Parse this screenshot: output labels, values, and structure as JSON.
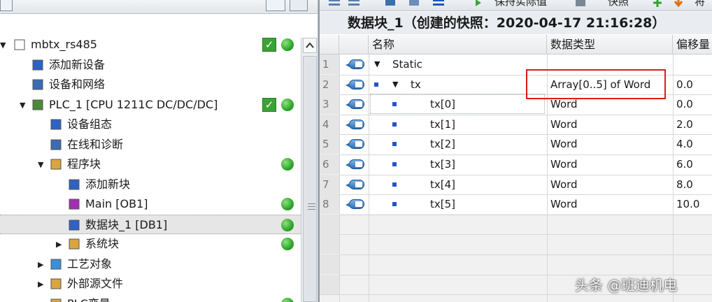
{
  "left_panel": {
    "items": [
      {
        "label": "mbtx_rs485",
        "arrow": "▼",
        "check": true,
        "dot": true,
        "icon": "document-icon"
      },
      {
        "label": "添加新设备",
        "icon": "add-device-icon"
      },
      {
        "label": "设备和网络",
        "icon": "network-icon"
      },
      {
        "label": "PLC_1 [CPU 1211C DC/DC/DC]",
        "arrow": "▼",
        "check": true,
        "dot": true,
        "icon": "plc-icon"
      },
      {
        "label": "设备组态",
        "icon": "device-config-icon"
      },
      {
        "label": "在线和诊断",
        "icon": "diagnostics-icon"
      },
      {
        "label": "程序块",
        "arrow": "▼",
        "dot": true,
        "icon": "folder-icon"
      },
      {
        "label": "添加新块",
        "icon": "add-block-icon"
      },
      {
        "label": "Main [OB1]",
        "dot": true,
        "icon": "ob-block-icon"
      },
      {
        "label": "数据块_1 [DB1]",
        "dot": true,
        "selected": true,
        "icon": "db-block-icon"
      },
      {
        "label": "系统块",
        "arrow": "▶",
        "dot": true,
        "icon": "folder-icon"
      },
      {
        "label": "工艺对象",
        "arrow": "▶",
        "icon": "tech-object-icon"
      },
      {
        "label": "外部源文件",
        "arrow": "▶",
        "icon": "external-source-icon"
      },
      {
        "label": "PLC变量",
        "arrow": "▶",
        "dot": true,
        "icon": "folder-icon"
      }
    ]
  },
  "editor": {
    "toolbar": {
      "keep_actual": "保持实际值",
      "snapshot": "快照"
    },
    "title": "数据块_1（创建的快照：2020-04-17 21:16:28）",
    "columns": {
      "name": "名称",
      "datatype": "数据类型",
      "offset": "偏移量"
    },
    "rows": [
      {
        "num": "1",
        "name": "Static",
        "datatype": "",
        "offset": "",
        "level": 0,
        "expand": "▼"
      },
      {
        "num": "2",
        "name": "tx",
        "datatype": "Array[0..5] of Word",
        "offset": "0.0",
        "level": 1,
        "expand": "▼"
      },
      {
        "num": "3",
        "name": "tx[0]",
        "datatype": "Word",
        "offset": "0.0",
        "level": 2
      },
      {
        "num": "4",
        "name": "tx[1]",
        "datatype": "Word",
        "offset": "2.0",
        "level": 2
      },
      {
        "num": "5",
        "name": "tx[2]",
        "datatype": "Word",
        "offset": "4.0",
        "level": 2
      },
      {
        "num": "6",
        "name": "tx[3]",
        "datatype": "Word",
        "offset": "6.0",
        "level": 2
      },
      {
        "num": "7",
        "name": "tx[4]",
        "datatype": "Word",
        "offset": "8.0",
        "level": 2
      },
      {
        "num": "8",
        "name": "tx[5]",
        "datatype": "Word",
        "offset": "10.0",
        "level": 2
      }
    ]
  },
  "watermark": "头条 @班迪机电",
  "colors": {
    "status_green": "#2ea52a",
    "highlight_red": "#e0191a",
    "member_icon_blue": "#2f6fb5"
  }
}
